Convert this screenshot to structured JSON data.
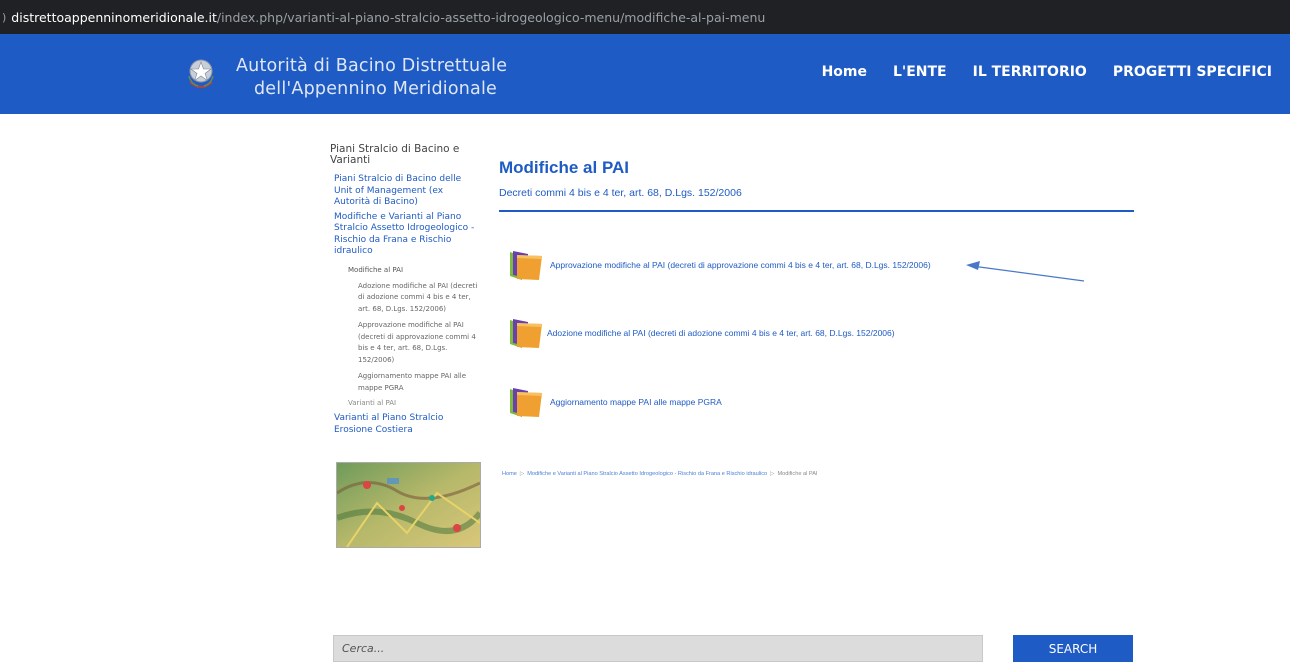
{
  "browser": {
    "url_domain": "distrettoappenninomeridionale.it",
    "url_path": "/index.php/varianti-al-piano-stralcio-assetto-idrogeologico-menu/modifiche-al-pai-menu"
  },
  "header": {
    "title_line1": "Autorità di Bacino Distrettuale",
    "title_line2": "dell'Appennino Meridionale",
    "background_color": "#1f5bc4",
    "nav": [
      "Home",
      "L'ENTE",
      "IL TERRITORIO",
      "PROGETTI SPECIFICI"
    ]
  },
  "sidebar": {
    "title": "Piani Stralcio di Bacino e Varianti",
    "items": [
      "Piani Stralcio di Bacino delle Unit of Management (ex Autorità di Bacino)",
      "Modifiche e Varianti al Piano Stralcio Assetto Idrogeologico - Rischio da Frana e Rischio idraulico"
    ],
    "sub_item": "Modifiche al PAI",
    "sub_sub_items": [
      "Adozione modifiche al PAI (decreti di adozione commi 4 bis e 4 ter, art. 68, D.Lgs. 152/2006)",
      "Approvazione modifiche al PAI (decreti di approvazione commi 4 bis e 4 ter, art. 68, D.Lgs. 152/2006)",
      "Aggiornamento mappe PAI alle mappe PGRA"
    ],
    "sub_item_2": "Varianti al PAI",
    "item_last": "Varianti al Piano Stralcio Erosione Costiera"
  },
  "main": {
    "title": "Modifiche al PAI",
    "subtitle": "Decreti commi 4 bis e 4 ter, art. 68, D.Lgs. 152/2006",
    "files": [
      "Approvazione modifiche al PAI (decreti di approvazione commi 4 bis e 4 ter, art. 68, D.Lgs. 152/2006)",
      "Adozione modifiche al PAI (decreti di adozione commi 4 bis e 4 ter, art. 68, D.Lgs. 152/2006)",
      "Aggiornamento mappe PAI alle mappe PGRA"
    ],
    "breadcrumb": [
      "Home",
      "Modifiche e Varianti al Piano Stralcio Assetto Idrogeologico - Rischio da Frana e Rischio idraulico",
      "Modifiche al PAI"
    ]
  },
  "search": {
    "placeholder": "Cerca...",
    "button_label": "SEARCH"
  }
}
